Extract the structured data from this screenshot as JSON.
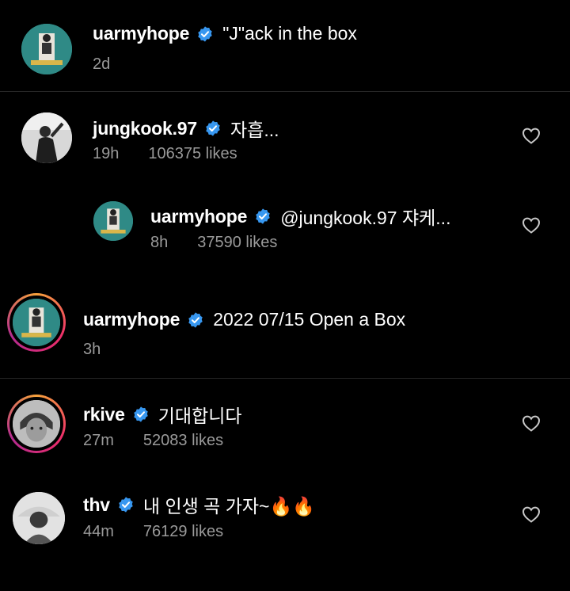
{
  "comments": [
    {
      "username": "uarmyhope",
      "text": "\"J\"ack in the box",
      "time": "2d",
      "likes": "",
      "avatar": "jack-in-the-box-cover"
    },
    {
      "username": "jungkook.97",
      "text": "자흡...",
      "time": "19h",
      "likes": "106375 likes",
      "avatar": "jungkook-photo"
    },
    {
      "username": "uarmyhope",
      "text": "@jungkook.97 쟈케...",
      "time": "8h",
      "likes": "37590 likes",
      "avatar": "jack-in-the-box-cover"
    },
    {
      "username": "uarmyhope",
      "text": "2022 07/15 Open a Box",
      "time": "3h",
      "likes": "",
      "avatar": "jack-in-the-box-cover"
    },
    {
      "username": "rkive",
      "text": "기대합니다",
      "time": "27m",
      "likes": "52083 likes",
      "avatar": "rkive-photo"
    },
    {
      "username": "thv",
      "text": "내 인생 곡 가자~🔥🔥",
      "time": "44m",
      "likes": "76129 likes",
      "avatar": "thv-photo"
    }
  ],
  "colors": {
    "background": "#000000",
    "verified": "#3797f0",
    "meta_text": "#9a9a9a",
    "story_ring": [
      "#f6a23b",
      "#ee2d6a",
      "#b32b8f"
    ]
  },
  "icons": {
    "verified": "verified-badge-icon",
    "like": "heart-outline-icon"
  }
}
